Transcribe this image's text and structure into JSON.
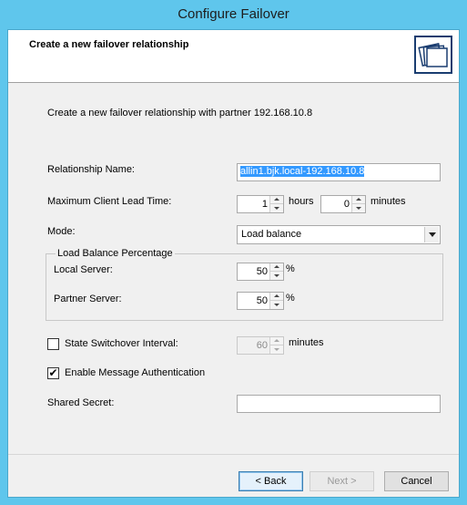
{
  "window": {
    "title": "Configure Failover",
    "accent_color": "#5fc6ec"
  },
  "header": {
    "title": "Create a new failover relationship",
    "icon": "folders-icon"
  },
  "form": {
    "intro": "Create a new failover relationship with partner 192.168.10.8",
    "relationship_name_label": "Relationship Name:",
    "relationship_name_value": "allin1.bjk.local-192.168.10.8",
    "mclt_label": "Maximum Client Lead Time:",
    "mclt_hours": "1",
    "hours_label": "hours",
    "mclt_minutes": "0",
    "minutes_label": "minutes",
    "mode_label": "Mode:",
    "mode_value": "Load balance",
    "lb_group_label": "Load Balance Percentage",
    "local_server_label": "Local Server:",
    "local_server_value": "50",
    "partner_server_label": "Partner Server:",
    "partner_server_value": "50",
    "percent_sign": "%",
    "state_switchover_label": "State Switchover Interval:",
    "state_switchover_checked": false,
    "state_switchover_value": "60",
    "state_switchover_unit": "minutes",
    "enable_auth_label": "Enable Message Authentication",
    "enable_auth_checked": true,
    "enable_auth_mark": "✔",
    "shared_secret_label": "Shared Secret:",
    "shared_secret_value": ""
  },
  "buttons": {
    "back": "< Back",
    "next": "Next >",
    "cancel": "Cancel"
  }
}
